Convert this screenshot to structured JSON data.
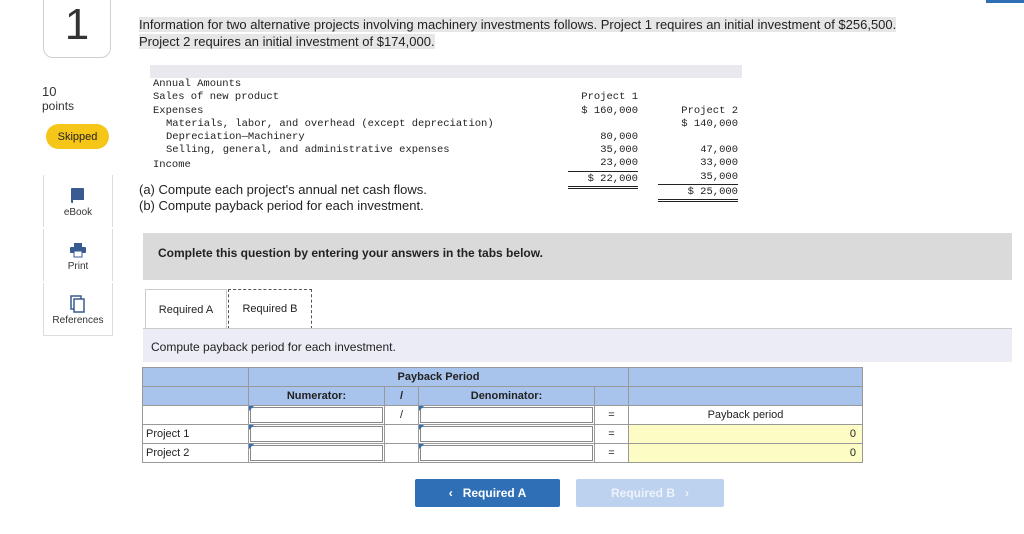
{
  "question": {
    "number": "1",
    "points_value": "10",
    "points_label": "points",
    "status": "Skipped"
  },
  "sidebar": [
    {
      "label": "eBook",
      "icon": "ebook-icon"
    },
    {
      "label": "Print",
      "icon": "print-icon"
    },
    {
      "label": "References",
      "icon": "references-icon"
    }
  ],
  "intro": {
    "line1": "Information for two alternative projects involving machinery investments follows. Project 1 requires an initial investment of $256,500.",
    "line2": "Project 2 requires an initial investment of $174,000."
  },
  "financials": {
    "header": {
      "label": "Annual Amounts",
      "p1": "Project 1",
      "p2": "Project 2"
    },
    "rows": [
      {
        "label": "Sales of new product",
        "p1": "$ 160,000",
        "p2": "$ 140,000"
      },
      {
        "label": "Expenses",
        "p1": "",
        "p2": ""
      },
      {
        "label": "Materials, labor, and overhead (except depreciation)",
        "p1": "80,000",
        "p2": "47,000"
      },
      {
        "label": "Depreciation—Machinery",
        "p1": "35,000",
        "p2": "33,000"
      },
      {
        "label": "Selling, general, and administrative expenses",
        "p1": "23,000",
        "p2": "35,000"
      },
      {
        "label": "Income",
        "p1": "$ 22,000",
        "p2": "$ 25,000"
      }
    ]
  },
  "parts": {
    "a": "(a) Compute each project's annual net cash flows.",
    "b": "(b) Compute payback period for each investment."
  },
  "banner": "Complete this question by entering your answers in the tabs below.",
  "tabs": {
    "a": "Required A",
    "b": "Required B"
  },
  "instruction": "Compute payback period for each investment.",
  "table": {
    "title": "Payback Period",
    "numerator": "Numerator:",
    "slash": "/",
    "denominator": "Denominator:",
    "equals": "=",
    "result_header": "Payback period",
    "rows": [
      {
        "label": "Project 1",
        "result": "0"
      },
      {
        "label": "Project 2",
        "result": "0"
      }
    ]
  },
  "nav": {
    "prev": "Required A",
    "next": "Required B"
  }
}
